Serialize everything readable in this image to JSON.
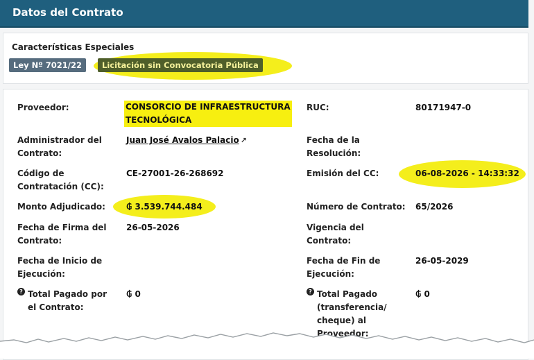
{
  "header": {
    "title": "Datos del Contrato"
  },
  "special": {
    "title": "Características Especiales",
    "badges": [
      "Ley Nº 7021/22",
      "Licitación sin Convocatoria Pública"
    ]
  },
  "details": {
    "proveedor": {
      "label": "Proveedor:",
      "value": "CONSORCIO DE INFRAESTRUCTURA\nTECNOLÓGICA"
    },
    "ruc": {
      "label": "RUC:",
      "value": "80171947-0"
    },
    "administrador": {
      "label": "Administrador del\nContrato:",
      "value": "Juan José Avalos Palacio"
    },
    "fecha_resolucion": {
      "label": "Fecha de la\nResolución:",
      "value": ""
    },
    "codigo": {
      "label": "Código de\nContratación (CC):",
      "value": "CE-27001-26-268692"
    },
    "emision": {
      "label": "Emisión del CC:",
      "value": "06-08-2026 - 14:33:32"
    },
    "monto": {
      "label": "Monto Adjudicado:",
      "value": "₲ 3.539.744.484"
    },
    "numero": {
      "label": "Número de Contrato:",
      "value": "65/2026"
    },
    "fecha_firma": {
      "label": "Fecha de Firma del\nContrato:",
      "value": "26-05-2026"
    },
    "vigencia": {
      "label": "Vigencia del\nContrato:",
      "value": ""
    },
    "fecha_inicio": {
      "label": "Fecha de Inicio de\nEjecución:",
      "value": ""
    },
    "fecha_fin": {
      "label": "Fecha de Fin de\nEjecución:",
      "value": "26-05-2029"
    },
    "total_pagado": {
      "label": "Total Pagado por\nel Contrato:",
      "value": "₲ 0"
    },
    "total_pagado_prov": {
      "label": "Total Pagado\n(transferencia/\ncheque) al\nProveedor:",
      "value": "₲ 0"
    }
  },
  "colors": {
    "header_bg": "#1f5f7e",
    "highlight": "#f4ee1c",
    "badge_ley": "#566c7e",
    "badge_lic": "#4f5f2a"
  }
}
